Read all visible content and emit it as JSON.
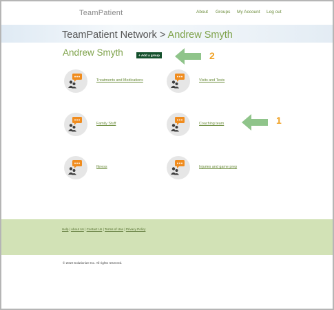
{
  "header": {
    "brand": "TeamPatient",
    "nav": [
      {
        "label": "About"
      },
      {
        "label": "Groups"
      },
      {
        "label": "My Account"
      },
      {
        "label": "Log out"
      }
    ]
  },
  "hero": {
    "network": "TeamPatient Network",
    "separator": " > ",
    "current": "Andrew Smyth"
  },
  "page": {
    "title": "Andrew Smyth",
    "add_group_label": "+ Add a group"
  },
  "annotations": {
    "label_1": "1",
    "label_2": "2",
    "arrow_color": "#8fc48a",
    "number_color": "#f0a020"
  },
  "groups": [
    {
      "label": "Treatments and Medications",
      "icon": "group-chat-icon"
    },
    {
      "label": "Visits and Tests",
      "icon": "group-chat-icon"
    },
    {
      "label": "Family Stuff",
      "icon": "group-chat-icon"
    },
    {
      "label": "Coaching team",
      "icon": "group-chat-icon"
    },
    {
      "label": "fitness",
      "icon": "group-chat-icon"
    },
    {
      "label": "Injuries and game prep",
      "icon": "group-chat-icon"
    }
  ],
  "footer": {
    "links": [
      {
        "label": "Help"
      },
      {
        "label": "About Us"
      },
      {
        "label": "Contact Us"
      },
      {
        "label": "Terms of Use"
      },
      {
        "label": "Privacy Policy"
      }
    ],
    "separator": " | ",
    "copyright": "© 2019 Solutionize Inc. All rights reserved."
  },
  "colors": {
    "brand_green": "#7ea24a",
    "button_green": "#14502c",
    "footer_band": "#d2e2b6",
    "chat_orange": "#f08c1e"
  }
}
